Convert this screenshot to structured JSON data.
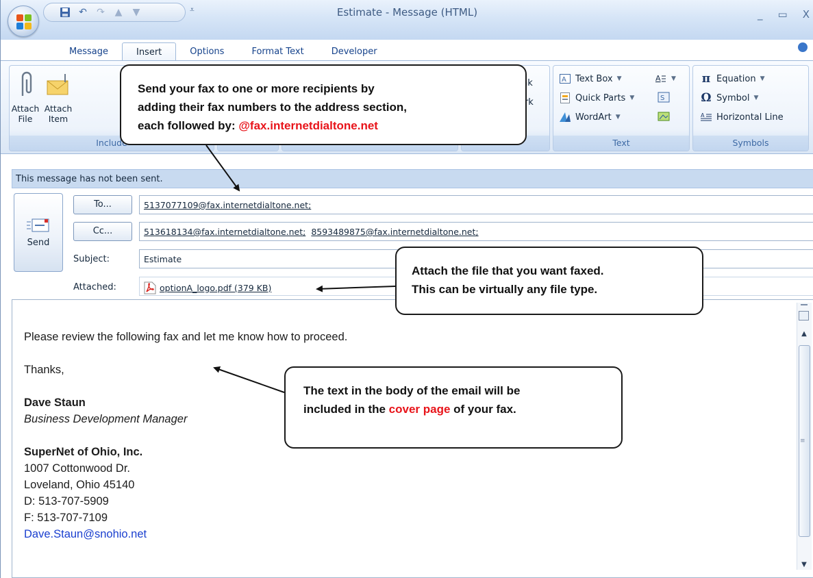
{
  "window": {
    "title": "Estimate - Message (HTML)",
    "controls": {
      "minimize": "_",
      "maximize": "▭",
      "close": "X"
    }
  },
  "tabs": [
    {
      "label": "Message"
    },
    {
      "label": "Insert"
    },
    {
      "label": "Options"
    },
    {
      "label": "Format Text"
    },
    {
      "label": "Developer"
    }
  ],
  "active_tab": "Insert",
  "ribbon": {
    "include": {
      "label": "Include",
      "attach_file": "Attach File",
      "attach_item": "Attach Item"
    },
    "links_partial": {
      "line1": "nk",
      "line2": "ark"
    },
    "text": {
      "label": "Text",
      "text_box": "Text Box",
      "quick_parts": "Quick Parts",
      "wordart": "WordArt"
    },
    "symbols": {
      "label": "Symbols",
      "equation": "Equation",
      "symbol": "Symbol",
      "horizontal_line": "Horizontal Line"
    }
  },
  "infobar": "This message has not been sent.",
  "header": {
    "send": "Send",
    "to_button": "To...",
    "cc_button": "Cc...",
    "subject_label": "Subject:",
    "attached_label": "Attached:",
    "to_value": "5137077109@fax.internetdialtone.net;",
    "cc_value_1": "513618134@fax.internetdialtone.net;",
    "cc_value_2": "8593489875@fax.internetdialtone.net;",
    "subject_value": "Estimate",
    "attachment": "optionA_logo.pdf (379 KB)"
  },
  "body": {
    "line1": "Please review the following fax and let me know how to proceed.",
    "line2": "Thanks,",
    "name": "Dave Staun",
    "role": "Business Development Manager",
    "company": "SuperNet of Ohio, Inc.",
    "address1": "1007 Cottonwood Dr.",
    "address2": "Loveland, Ohio 45140",
    "phone": "D: 513-707-5909",
    "fax": "F: 513-707-7109",
    "email": "Dave.Staun@snohio.net"
  },
  "callouts": {
    "c1_line1": "Send your fax to one or more recipients by",
    "c1_line2": "adding their fax numbers to the address section,",
    "c1_line3_prefix": "each followed by: ",
    "c1_line3_highlight": "@fax.internetdialtone.net",
    "c2_line1": "Attach the file that you want faxed.",
    "c2_line2": "This can be virtually any file type.",
    "c3_line1": "The text in the body of the email will be",
    "c3_line2_prefix": "included in the ",
    "c3_line2_highlight": "cover page",
    "c3_line2_suffix": " of your fax."
  },
  "colors": {
    "callout_highlight": "#e8141a",
    "ribbon_blue": "#15428b",
    "link_blue": "#1a3fcf"
  }
}
